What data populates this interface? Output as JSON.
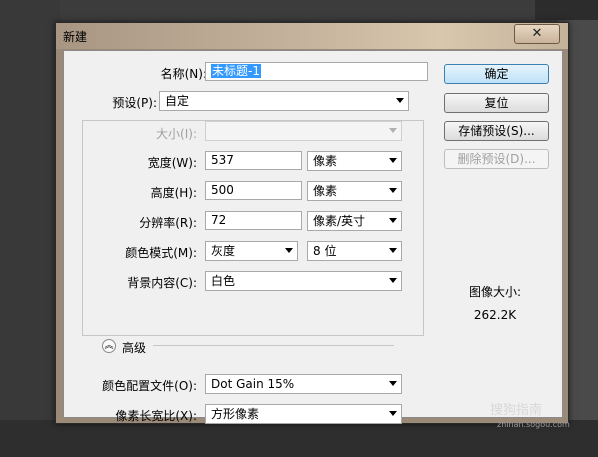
{
  "dialog": {
    "title": "新建",
    "close_glyph": "✕"
  },
  "form": {
    "name_label": "名称(N):",
    "name_value": "未标题-1",
    "preset_label": "预设(P):",
    "preset_value": "自定",
    "size_label": "大小(I):",
    "size_value": "",
    "width_label": "宽度(W):",
    "width_value": "537",
    "width_unit": "像素",
    "height_label": "高度(H):",
    "height_value": "500",
    "height_unit": "像素",
    "resolution_label": "分辨率(R):",
    "resolution_value": "72",
    "resolution_unit": "像素/英寸",
    "colormode_label": "颜色模式(M):",
    "colormode_value": "灰度",
    "bitdepth_value": "8 位",
    "background_label": "背景内容(C):",
    "background_value": "白色",
    "advanced_label": "高级",
    "advanced_toggle_glyph": "︽",
    "profile_label": "颜色配置文件(O):",
    "profile_value": "Dot Gain 15%",
    "aspect_label": "像素长宽比(X):",
    "aspect_value": "方形像素"
  },
  "buttons": {
    "ok": "确定",
    "reset": "复位",
    "save_preset": "存储预设(S)...",
    "delete_preset": "删除预设(D)..."
  },
  "info": {
    "image_size_label": "图像大小:",
    "image_size_value": "262.2K"
  },
  "watermark": {
    "text": "搜狗指南",
    "url": "zhinan.sogou.com"
  }
}
